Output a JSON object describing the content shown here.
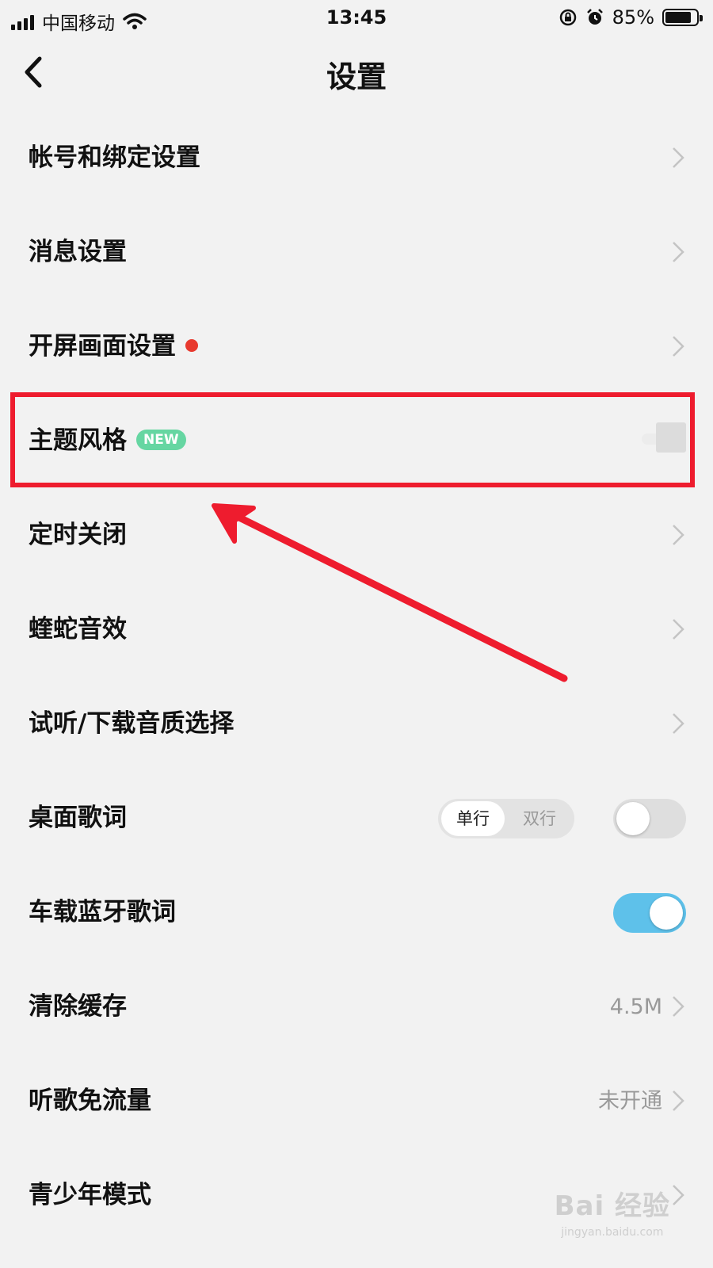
{
  "status_bar": {
    "carrier": "中国移动",
    "time": "13:45",
    "battery_pct": "85%",
    "battery_level": 0.85,
    "icons": [
      "signal-icon",
      "wifi-icon",
      "rotation-lock-icon",
      "alarm-icon",
      "battery-icon"
    ]
  },
  "header": {
    "title": "设置",
    "back_icon": "chevron-left-icon"
  },
  "settings": [
    {
      "label": "帐号和绑定设置"
    },
    {
      "label": "消息设置"
    },
    {
      "label": "开屏画面设置",
      "has_red_dot": true
    },
    {
      "label": "主题风格",
      "badge": "NEW"
    },
    {
      "label": "定时关闭"
    },
    {
      "label": "蝰蛇音效"
    },
    {
      "label": "试听/下载音质选择"
    },
    {
      "label": "桌面歌词",
      "segmented": {
        "options": [
          "单行",
          "双行"
        ],
        "selected": "单行"
      },
      "toggle": false
    },
    {
      "label": "车载蓝牙歌词",
      "toggle": true
    },
    {
      "label": "清除缓存",
      "value": "4.5M"
    },
    {
      "label": "听歌免流量",
      "value": "未开通"
    },
    {
      "label": "青少年模式"
    }
  ],
  "watermark": {
    "main": "Bai 经验",
    "sub": "jingyan.baidu.com"
  },
  "colors": {
    "background": "#f2f2f2",
    "red_dot": "#e8392e",
    "badge": "#66d6a2",
    "toggle_on": "#5ec1ea",
    "annotation": "#ee1c2e"
  }
}
